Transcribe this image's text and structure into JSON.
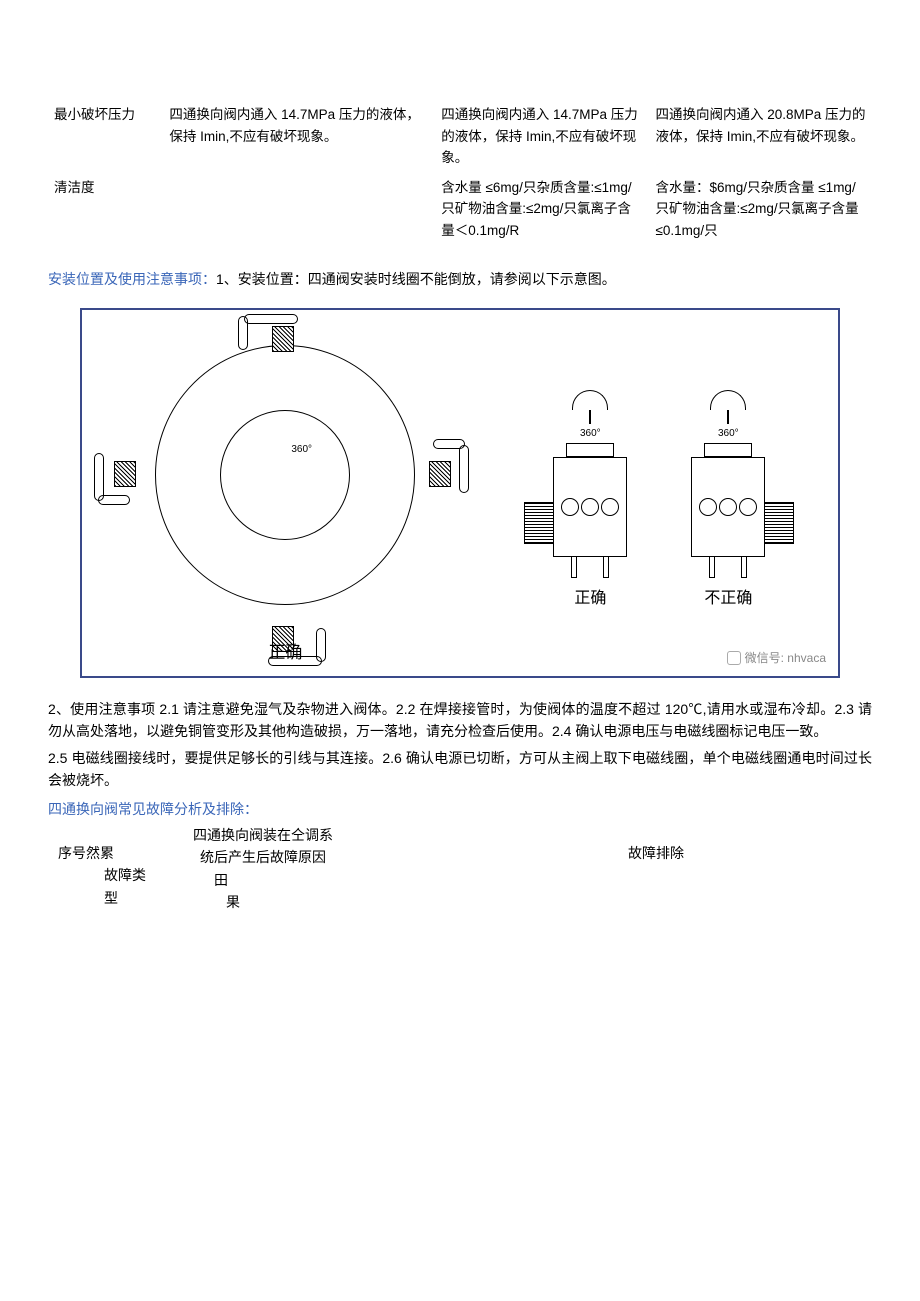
{
  "spec_table": {
    "row1": {
      "label": "最小破坏压力",
      "c2": "四通换向阀内通入 14.7MPa 压力的液体，保持 Imin,不应有破坏现象。",
      "c3": "四通换向阀内通入 14.7MPa 压力的液体，保持 Imin,不应有破坏现象。",
      "c4": "四通换向阀内通入 20.8MPa 压力的液体，保持 Imin,不应有破坏现象。"
    },
    "row2": {
      "label": "清洁度",
      "c2": "",
      "c3": "含水量 ≤6mg/只杂质含量:≤1mg/只矿物油含量:≤2mg/只氯离子含量＜0.1mg/R",
      "c4": "含水量：$6mg/只杂质含量 ≤1mg/只矿物油含量:≤2mg/只氯离子含量≤0.1mg/只"
    }
  },
  "install_heading_blue": "安装位置及使用注意事项：",
  "install_heading_rest": "1、安装位置：四通阀安装时线圈不能倒放，请参阅以下示意图。",
  "diagram": {
    "angle": "360°",
    "left_caption": "正确",
    "right_correct": "正确",
    "right_incorrect": "不正确",
    "watermark_label": "微信号: nhvaca"
  },
  "usage_p1": "2、使用注意事项 2.1 请注意避免湿气及杂物进入阀体。2.2 在焊接接管时，为使阀体的温度不超过 120℃,请用水或湿布冷却。2.3 请勿从高处落地，以避免铜管变形及其他构造破损，万一落地，请充分检查后使用。2.4 确认电源电压与电磁线圈标记电压一致。",
  "usage_p2": "2.5 电磁线圈接线时，要提供足够长的引线与其连接。2.6 确认电源已切断，方可从主阀上取下电磁线圈，单个电磁线圈通电时间过长会被烧坏。",
  "troubleshoot_heading": "四通换向阀常见故障分析及排除：",
  "trouble_table": {
    "col1_line1": "序号然累",
    "col1_line2": "故障类型",
    "col2_line1": "四通换向阀装在仝调系",
    "col2_line2": "统后产生后故障原因",
    "col2_line3": "田",
    "col2_line4": "果",
    "col3": "故障排除"
  }
}
